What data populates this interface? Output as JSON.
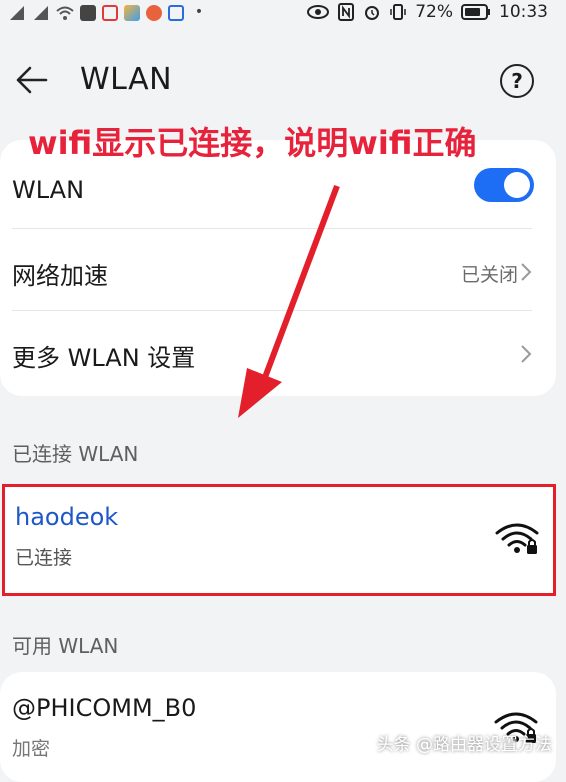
{
  "status_bar": {
    "battery": "72%",
    "time": "10:33"
  },
  "header": {
    "title": "WLAN",
    "help_glyph": "?"
  },
  "annotation": "wifi显示已连接，说明wifi正确",
  "settings": {
    "wlan_label": "WLAN",
    "wlan_on": true,
    "network_accel_label": "网络加速",
    "network_accel_value": "已关闭",
    "more_settings_label": "更多 WLAN 设置"
  },
  "connected_section": {
    "heading": "已连接 WLAN",
    "ssid": "haodeok",
    "status": "已连接"
  },
  "available_section": {
    "heading": "可用 WLAN",
    "networks": [
      {
        "ssid": "@PHICOMM_B0",
        "status": "加密"
      }
    ]
  },
  "watermark": "头条 @路由器设置方法",
  "colors": {
    "accent": "#1d6ef5",
    "annotation": "#e7223b",
    "ssid": "#1e58c7",
    "highlight_border": "#e21f2a"
  },
  "icons": [
    "back-arrow-icon",
    "help-icon",
    "toggle-switch",
    "chevron-right-icon",
    "wifi-locked-icon"
  ]
}
